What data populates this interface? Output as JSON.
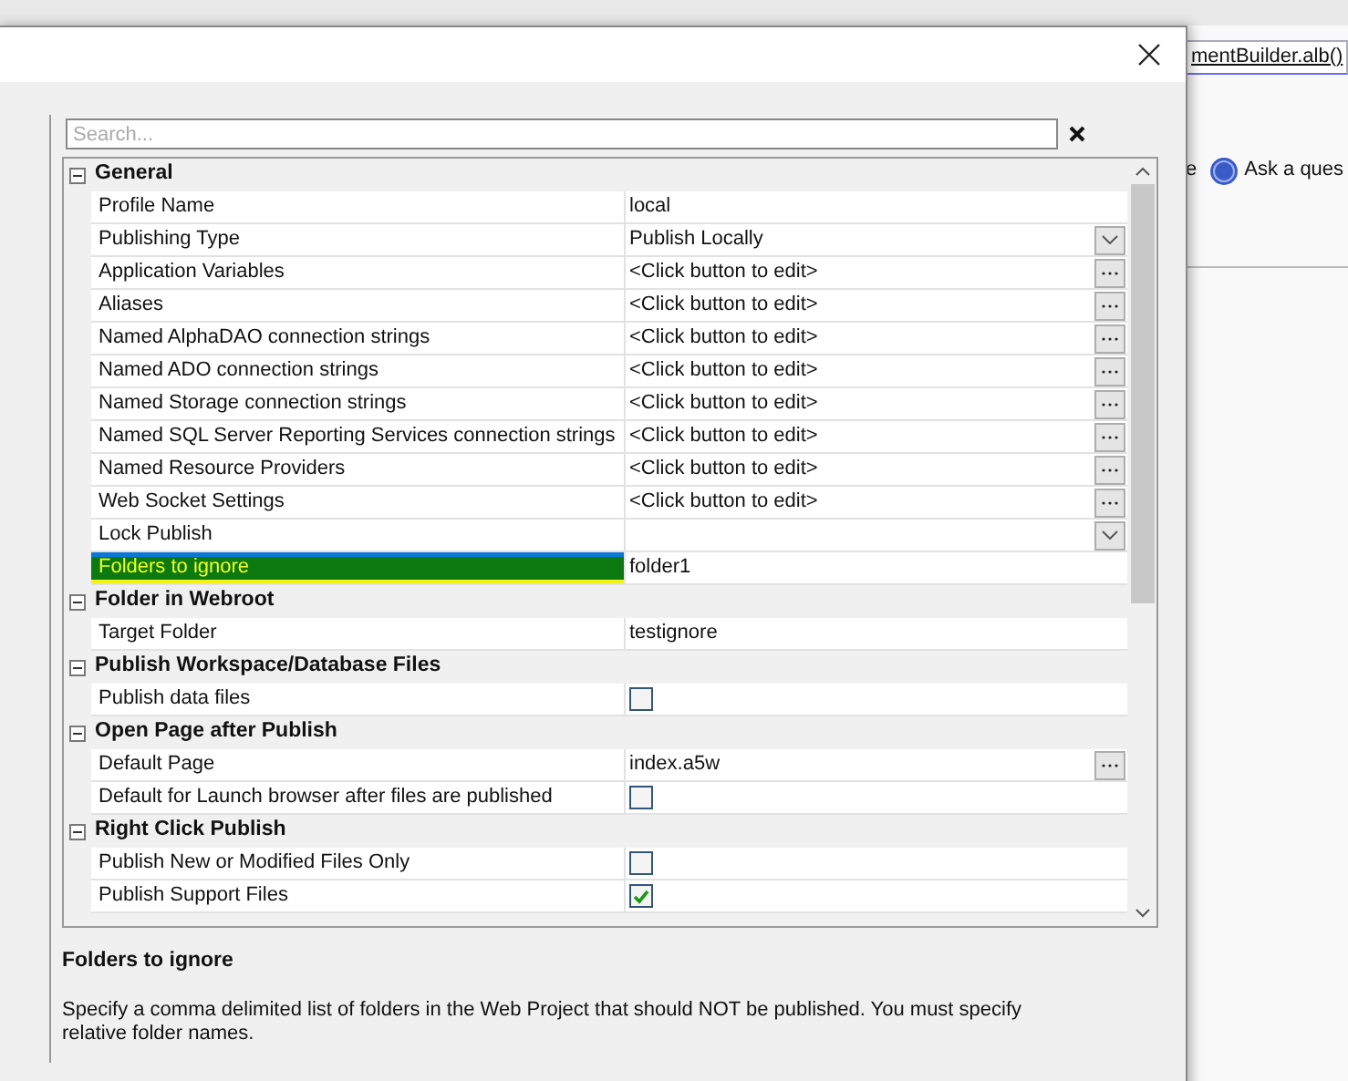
{
  "background_app": {
    "tab": "mentBuilder.alb()",
    "toolbar_text": "e",
    "help_link": "Ask a ques"
  },
  "dialog": {
    "search": {
      "placeholder": "Search..."
    },
    "groups": [
      {
        "name": "General",
        "expanded": true,
        "rows": [
          {
            "label": "Profile Name",
            "kind": "text",
            "value": "local",
            "selected": false
          },
          {
            "label": "Publishing Type",
            "kind": "dropdown",
            "value": "Publish Locally",
            "selected": false
          },
          {
            "label": "Application Variables",
            "kind": "ellipsis",
            "value": "<Click button to edit>",
            "selected": false
          },
          {
            "label": "Aliases",
            "kind": "ellipsis",
            "value": "<Click button to edit>",
            "selected": false
          },
          {
            "label": "Named AlphaDAO connection strings",
            "kind": "ellipsis",
            "value": "<Click button to edit>",
            "selected": false
          },
          {
            "label": "Named ADO connection strings",
            "kind": "ellipsis",
            "value": "<Click button to edit>",
            "selected": false
          },
          {
            "label": "Named Storage connection strings",
            "kind": "ellipsis",
            "value": "<Click button to edit>",
            "selected": false
          },
          {
            "label": "Named SQL Server Reporting Services connection strings",
            "kind": "ellipsis",
            "value": "<Click button to edit>",
            "selected": false
          },
          {
            "label": "Named Resource Providers",
            "kind": "ellipsis",
            "value": "<Click button to edit>",
            "selected": false
          },
          {
            "label": "Web Socket Settings",
            "kind": "ellipsis",
            "value": "<Click button to edit>",
            "selected": false
          },
          {
            "label": "Lock Publish",
            "kind": "dropdown",
            "selected": false
          },
          {
            "label": "Folders to ignore",
            "kind": "text",
            "value": "folder1",
            "selected": true
          }
        ]
      },
      {
        "name": "Folder in Webroot",
        "expanded": true,
        "rows": [
          {
            "label": "Target Folder",
            "kind": "text",
            "value": "testignore",
            "selected": false
          }
        ]
      },
      {
        "name": "Publish Workspace/Database Files",
        "expanded": true,
        "rows": [
          {
            "label": "Publish data files",
            "kind": "checkbox",
            "checked": false,
            "selected": false
          }
        ]
      },
      {
        "name": "Open Page after Publish",
        "expanded": true,
        "rows": [
          {
            "label": "Default Page",
            "kind": "ellipsis",
            "value": "index.a5w",
            "selected": false
          },
          {
            "label": "Default for Launch browser after files are published",
            "kind": "checkbox",
            "checked": false,
            "selected": false
          }
        ]
      },
      {
        "name": "Right Click Publish",
        "expanded": true,
        "rows": [
          {
            "label": "Publish New or Modified Files Only",
            "kind": "checkbox",
            "checked": false,
            "selected": false
          },
          {
            "label": "Publish Support Files",
            "kind": "checkbox",
            "checked": true,
            "selected": false
          }
        ]
      }
    ],
    "description": {
      "title": "Folders to ignore",
      "text": "Specify a comma delimited list of folders in the Web Project that should NOT be published. You must specify relative folder names."
    }
  }
}
